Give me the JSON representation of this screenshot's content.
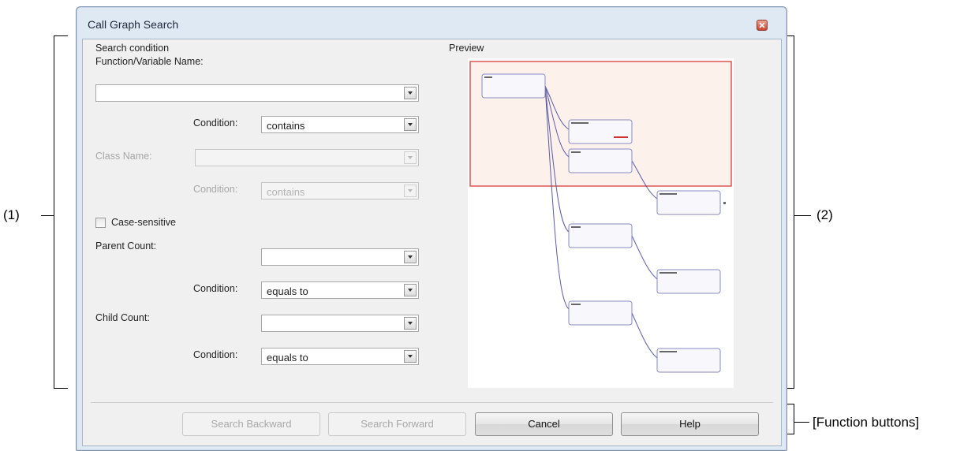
{
  "dialog": {
    "title": "Call Graph Search",
    "close_icon": "close-icon"
  },
  "search": {
    "group_label": "Search condition",
    "name_label": "Function/Variable Name:",
    "name_value": "",
    "condition_label": "Condition:",
    "condition_value": "contains",
    "class_name_label": "Class Name:",
    "class_name_value": "",
    "class_condition_label": "Condition:",
    "class_condition_value": "contains",
    "case_sensitive_label": "Case-sensitive",
    "case_sensitive_checked": false,
    "parent_count_label": "Parent Count:",
    "parent_count_value": "",
    "parent_condition_label": "Condition:",
    "parent_condition_value": "equals to",
    "child_count_label": "Child Count:",
    "child_count_value": "",
    "child_condition_label": "Condition:",
    "child_condition_value": "equals to"
  },
  "preview": {
    "label": "Preview"
  },
  "buttons": {
    "search_backward": "Search Backward",
    "search_forward": "Search Forward",
    "cancel": "Cancel",
    "help": "Help"
  },
  "annotations": {
    "left": "(1)",
    "right": "(2)",
    "buttons": "[Function buttons]"
  }
}
